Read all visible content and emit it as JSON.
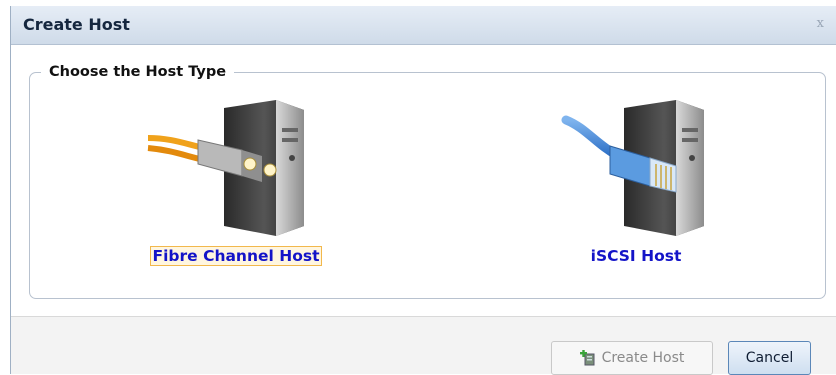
{
  "dialog": {
    "title": "Create Host",
    "close_label": "x"
  },
  "group": {
    "legend": "Choose the Host Type"
  },
  "options": [
    {
      "label": "Fibre Channel Host",
      "icon": "fibre-channel-server-icon",
      "focused": true
    },
    {
      "label": "iSCSI Host",
      "icon": "ethernet-server-icon",
      "focused": false
    }
  ],
  "buttons": {
    "create": {
      "label": "Create Host",
      "enabled": false,
      "icon": "add-host-icon"
    },
    "cancel": {
      "label": "Cancel",
      "enabled": true
    }
  },
  "colors": {
    "link": "#1414c8",
    "titlebar": "#cfdbe9",
    "focus": "#f2b84c"
  }
}
